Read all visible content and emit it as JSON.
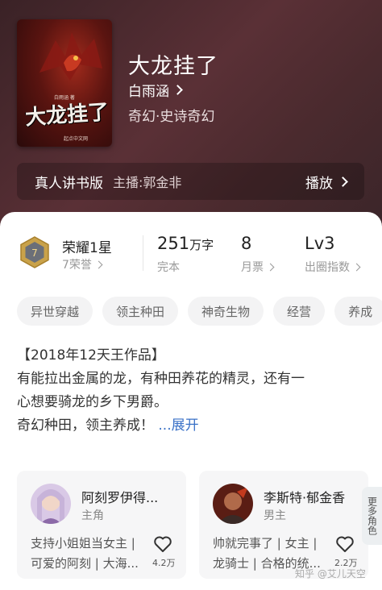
{
  "book": {
    "title": "大龙挂了",
    "author": "白雨涵",
    "genre": "奇幻·史诗奇幻",
    "cover": {
      "title_art": "大龙挂了",
      "author_small": "白雨涵 著",
      "publisher_small": "起点中文网"
    }
  },
  "audio": {
    "label": "真人讲书版",
    "host": "主播:郭金非",
    "play": "播放"
  },
  "stats": {
    "honor_title": "荣耀1星",
    "honor_sub": "7荣誉",
    "honor_badge_num": "7",
    "words_value": "251",
    "words_unit": "万字",
    "words_label": "完本",
    "monthly_value": "8",
    "monthly_label": "月票",
    "level_value": "Lv3",
    "level_label": "出圈指数"
  },
  "tags": [
    "异世穿越",
    "领主种田",
    "神奇生物",
    "经营",
    "养成"
  ],
  "description": {
    "line1": "【2018年12天王作品】",
    "line2": "有能拉出金属的龙，有种田养花的精灵，还有一",
    "line3": "心想要骑龙的乡下男爵。",
    "line4": "奇幻种田，领主养成！",
    "expand": " ...展开"
  },
  "characters": [
    {
      "name": "阿刻罗伊得...",
      "role": "主角",
      "desc1": "支持小姐姐当女主 |",
      "desc2": "可爱的阿刻 | 大海...",
      "likes": "4.2万"
    },
    {
      "name": "李斯特·郁金香",
      "role": "男主",
      "desc1": "帅就完事了 | 女主 |",
      "desc2": "龙骑士 | 合格的统...",
      "likes": "2.2万"
    }
  ],
  "more_characters": "更多角色",
  "watermark": "知乎 @艾儿天空",
  "colors": {
    "accent": "#3a71c7",
    "hero_bg": "#4a2a2e",
    "badge_gold": "#c9a24a"
  }
}
